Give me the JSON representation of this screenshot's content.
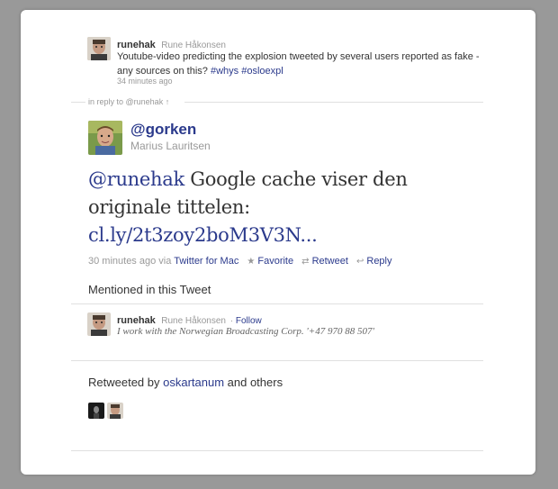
{
  "parent_tweet": {
    "username": "runehak",
    "fullname": "Rune Håkonsen",
    "text_before": "Youtube-video predicting the explosion tweeted by several users reported as fake - any sources on this? ",
    "hashtag1": "#whys",
    "hashtag2": "#osloexpl",
    "timestamp": "34 minutes ago"
  },
  "in_reply_to": {
    "prefix": "in reply to ",
    "user": "@runehak",
    "arrow": "↑"
  },
  "main_tweet": {
    "handle": "@gorken",
    "fullname": "Marius Lauritsen",
    "mention": "@runehak",
    "text_line1": " Google cache viser den",
    "text_line2": "originale tittelen:",
    "link": "cl.ly/2t3zoy2boM3V3N...",
    "timestamp": "30 minutes ago",
    "via": " via ",
    "client": "Twitter for Mac",
    "actions": {
      "favorite": "Favorite",
      "retweet": "Retweet",
      "reply": "Reply"
    }
  },
  "mentioned": {
    "title": "Mentioned in this Tweet",
    "username": "runehak",
    "fullname": "Rune Håkonsen",
    "separator": " · ",
    "follow": "Follow",
    "bio": "I work with the Norwegian Broadcasting Corp. '+47 970 88 507'"
  },
  "retweeted": {
    "prefix": "Retweeted by ",
    "user": "oskartanum",
    "suffix": " and others"
  },
  "icons": {
    "favorite": "star-icon",
    "retweet": "retweet-icon",
    "reply": "reply-icon",
    "up_arrow": "up-arrow-icon"
  },
  "colors": {
    "background": "#999999",
    "card": "#ffffff",
    "link": "#2b3a8c",
    "muted": "#999999"
  }
}
